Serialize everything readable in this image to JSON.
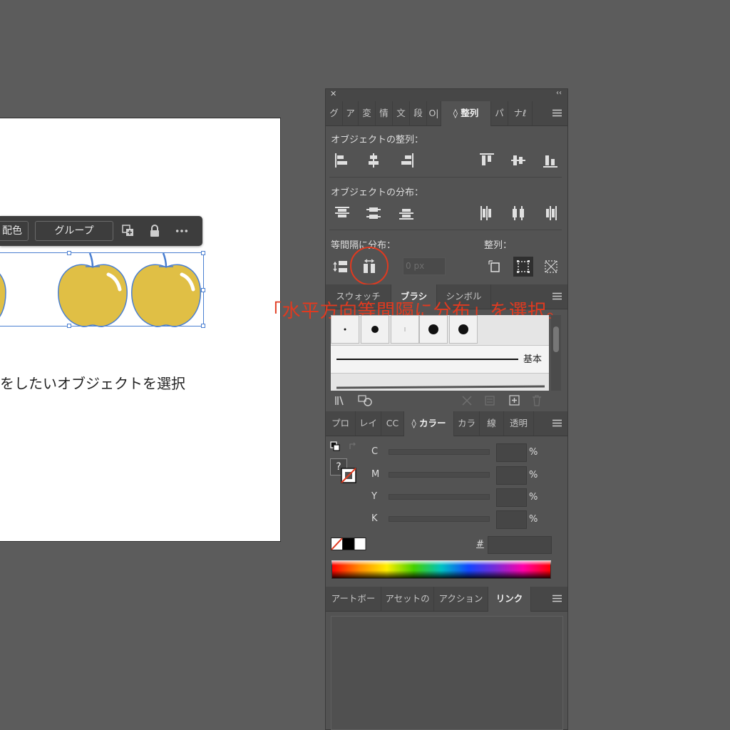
{
  "artboard": {
    "context_bar": {
      "recolor_label": "配色",
      "group_label": "グループ"
    },
    "instruction": "をしたいオブジェクトを選択"
  },
  "annotation": {
    "text": "「水平方向等間隔に分布」を選択。",
    "color": "#e03a20"
  },
  "panel_top": {
    "tabs": [
      "グ",
      "ア",
      "変",
      "情",
      "文",
      "段",
      "O|",
      "◊ 整列",
      "パ",
      "ナℓ"
    ],
    "active_tab": "整列",
    "align_objects_label": "オブジェクトの整列：",
    "distribute_objects_label": "オブジェクトの分布：",
    "distribute_spacing_label": "等間隔に分布：",
    "align_to_label": "整列：",
    "spacing_value": "0 px"
  },
  "panel_brush": {
    "tabs": [
      "スウォッチ",
      "ブラシ",
      "シンボル"
    ],
    "active_tab": "ブラシ",
    "basic_brush_label": "基本"
  },
  "panel_color": {
    "tabs": [
      "プロ",
      "レイ",
      "CC",
      "◊ カラー",
      "カラ",
      "線",
      "透明"
    ],
    "active_tab": "カラー",
    "channels": [
      {
        "label": "C",
        "unit": "%"
      },
      {
        "label": "M",
        "unit": "%"
      },
      {
        "label": "Y",
        "unit": "%"
      },
      {
        "label": "K",
        "unit": "%"
      }
    ],
    "hex_label": "#",
    "unknown_color_glyph": "?"
  },
  "panel_links": {
    "tabs": [
      "アートボー",
      "アセットの",
      "アクション",
      "リンク"
    ],
    "active_tab": "リンク"
  },
  "colors": {
    "apple_fill": "#e0bf45",
    "apple_stroke": "#4a7fd1",
    "selection": "#4a7fd1"
  }
}
